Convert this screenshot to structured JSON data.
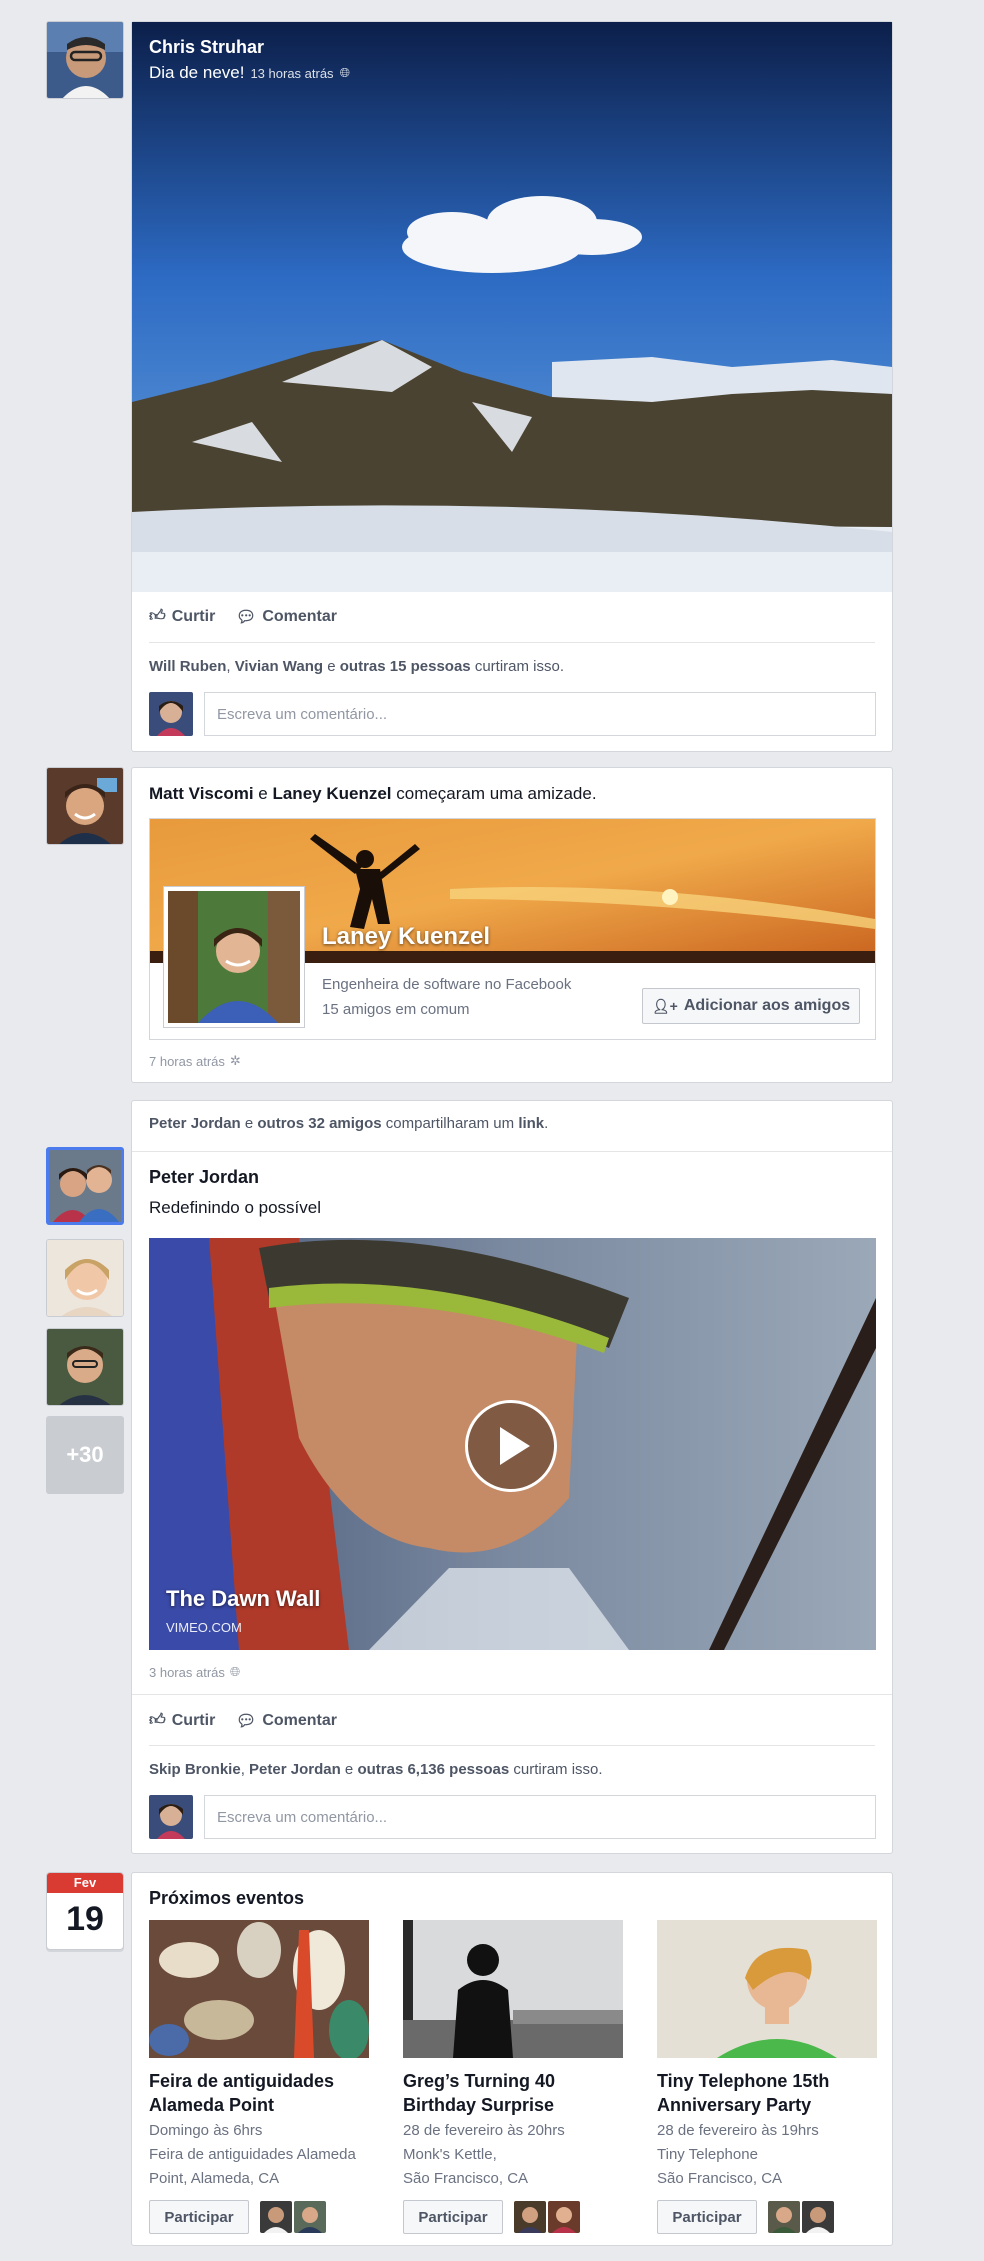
{
  "post1": {
    "author": "Chris Struhar",
    "text": "Dia de neve!",
    "time": "13 horas atrás",
    "like_label": "Curtir",
    "comment_label": "Comentar",
    "likes_names_1": "Will Ruben",
    "likes_sep_1": ", ",
    "likes_names_2": "Vivian Wang",
    "likes_mid": " e ",
    "likes_others": "outras 15 pessoas",
    "likes_suffix": " curtiram isso.",
    "comment_placeholder": "Escreva um comentário..."
  },
  "post2": {
    "person1": "Matt Viscomi",
    "conj": " e ",
    "person2": "Laney Kuenzel",
    "suffix": " começaram uma amizade.",
    "friend_name": "Laney Kuenzel",
    "friend_job": "Engenheira de software no Facebook",
    "friend_mutual": "15 amigos em comum",
    "add_friend_label": "Adicionar aos amigos",
    "time": "7 horas atrás"
  },
  "post3": {
    "share_name": "Peter Jordan",
    "share_mid": " e ",
    "share_others": "outros 32 amigos",
    "share_suffix": " compartilharam um ",
    "share_link": "link",
    "share_end": ".",
    "more_count": "+30",
    "author": "Peter Jordan",
    "text": "Redefinindo o possível",
    "video_title": "The Dawn Wall",
    "video_source": "VIMEO.COM",
    "time": "3 horas atrás",
    "like_label": "Curtir",
    "comment_label": "Comentar",
    "likes_names_1": "Skip Bronkie",
    "likes_sep_1": ", ",
    "likes_names_2": "Peter Jordan",
    "likes_mid": " e ",
    "likes_others": "outras 6,136 pessoas",
    "likes_suffix": " curtiram isso.",
    "comment_placeholder": "Escreva um comentário..."
  },
  "events": {
    "cal_month": "Fev",
    "cal_day": "19",
    "heading": "Próximos eventos",
    "items": [
      {
        "title_1": "Feira de antiguidades",
        "title_2": "Alameda Point",
        "when": "Domingo às 6hrs",
        "where_1": "Feira de antiguidades Alameda",
        "where_2": "Point, Alameda, CA",
        "join": "Participar"
      },
      {
        "title_1": "Greg’s Turning 40",
        "title_2": "Birthday Surprise",
        "when": "28 de fevereiro às 20hrs",
        "where_1": "Monk's Kettle,",
        "where_2": "São Francisco, CA",
        "join": "Participar"
      },
      {
        "title_1": "Tiny Telephone 15th",
        "title_2": "Anniversary Party",
        "when": "28 de fevereiro às 19hrs",
        "where_1": "Tiny Telephone",
        "where_2": "São Francisco, CA",
        "join": "Participar"
      }
    ]
  },
  "colors": {
    "background": "#e9eaed",
    "link_text": "#141823",
    "muted": "#9197a3",
    "calendar_red": "#d93a31",
    "avatar_selected": "#4b7bec"
  }
}
